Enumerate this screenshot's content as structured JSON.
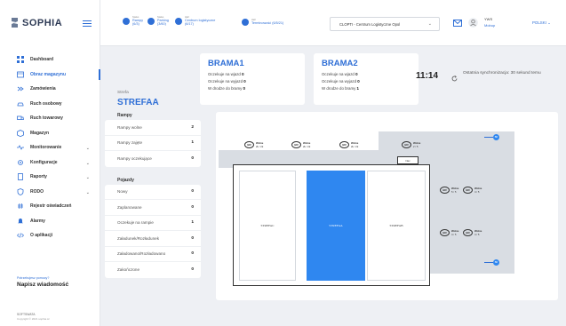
{
  "app": {
    "name": "SOPHIA"
  },
  "sidebar": {
    "items": [
      {
        "label": "Dashboard",
        "icon": "grid-icon"
      },
      {
        "label": "Obraz magazynu",
        "icon": "map-icon",
        "active": true
      },
      {
        "label": "Zamówienia",
        "icon": "orders-icon"
      },
      {
        "label": "Ruch osobowy",
        "icon": "car-icon"
      },
      {
        "label": "Ruch towarowy",
        "icon": "truck-icon"
      },
      {
        "label": "Magazyn",
        "icon": "box-icon"
      },
      {
        "label": "Monitorowanie",
        "icon": "pulse-icon",
        "chevron": "⌄"
      },
      {
        "label": "Konfiguracje",
        "icon": "gear-icon",
        "chevron": "⌄"
      },
      {
        "label": "Raporty",
        "icon": "document-icon",
        "chevron": "⌄"
      },
      {
        "label": "RODO",
        "icon": "shield-icon",
        "chevron": "⌄"
      },
      {
        "label": "Rejestr oświadczeń",
        "icon": "hash-icon"
      },
      {
        "label": "Alarmy",
        "icon": "bell-icon"
      },
      {
        "label": "O aplikacji",
        "icon": "code-icon"
      }
    ],
    "feedback": {
      "question": "Potrzebujesz pomocy?",
      "action": "Napisz wiadomość"
    },
    "footer": {
      "company": "SOFTSWATA",
      "copyright": "Copyright © 2021 sophia.cc"
    }
  },
  "topbar": {
    "stats": [
      {
        "label": "Status",
        "value_1": "Rampy",
        "value_2": "(6/3)"
      },
      {
        "label": "Status",
        "value_1": "Parking",
        "value_2": "(3/60)"
      },
      {
        "label": "Hall",
        "value_1": "Centrum logistyczne",
        "value_2": "(6/17)"
      },
      {
        "label": "Hall",
        "value_1": "Terminowość (6/5/21)",
        "value_2": ""
      }
    ],
    "location_select": "CLOPTI - Centrum Logistyczne Opol",
    "user": {
      "name": "YWS",
      "role": "Mobup"
    },
    "language": "POLSKI"
  },
  "zone": {
    "label": "Strefa",
    "value": "STREFAA"
  },
  "gates": [
    {
      "title": "BRAMA1",
      "rows": [
        {
          "label": "Oczekuje na wjazd",
          "value": "0"
        },
        {
          "label": "Oczekuje na wyjazd",
          "value": "0"
        },
        {
          "label": "W drodze do bramy",
          "value": "0"
        }
      ]
    },
    {
      "title": "BRAMA2",
      "rows": [
        {
          "label": "Oczekuje na wjazd",
          "value": "0"
        },
        {
          "label": "Oczekuje na wyjazd",
          "value": "0"
        },
        {
          "label": "W drodze do bramy",
          "value": "1"
        }
      ]
    }
  ],
  "clock": "11:14",
  "sync_text": "Ostatnia synchronizacja: 30 sekund temu",
  "ramps": {
    "title": "Rampy",
    "rows": [
      {
        "label": "Rampy wolne",
        "value": "2"
      },
      {
        "label": "Rampy zajęte",
        "value": "1"
      },
      {
        "label": "Rampy oczekujące",
        "value": "0"
      }
    ]
  },
  "vehicles": {
    "title": "Pojazdy",
    "rows": [
      {
        "label": "Nowy",
        "value": "0"
      },
      {
        "label": "Zaplanowane",
        "value": "0"
      },
      {
        "label": "Oczekuje na rampie",
        "value": "1"
      },
      {
        "label": "Załadunek/Rozładunek",
        "value": "0"
      },
      {
        "label": "Załadowano/Rozładowano",
        "value": "0"
      },
      {
        "label": "Zakończone",
        "value": "0"
      }
    ]
  },
  "map": {
    "zones": [
      {
        "label": "STREFAC",
        "selected": false
      },
      {
        "label": "STREFAA",
        "selected": true
      },
      {
        "label": "STREFAB",
        "selected": false
      }
    ],
    "door_label": "Nav",
    "gates": [
      {
        "status": "Wolne",
        "count": "2k / 2k"
      },
      {
        "status": "Wolne",
        "count": "2k / 2k"
      },
      {
        "status": "Wolne",
        "count": "2k / 2k"
      },
      {
        "status": "Wolne",
        "count": "2 / 5"
      },
      {
        "status": "Wolne",
        "count": "5 / 5"
      },
      {
        "status": "Wolne",
        "count": "4 / 5"
      },
      {
        "status": "Wolne",
        "count": "4 / 5"
      },
      {
        "status": "Wolne",
        "count": "4 / 5"
      }
    ],
    "markers": [
      "BR",
      "BR"
    ]
  },
  "colors": {
    "accent": "#2f6fd6",
    "selected_zone": "#2f87f0",
    "background": "#eef0f4"
  }
}
